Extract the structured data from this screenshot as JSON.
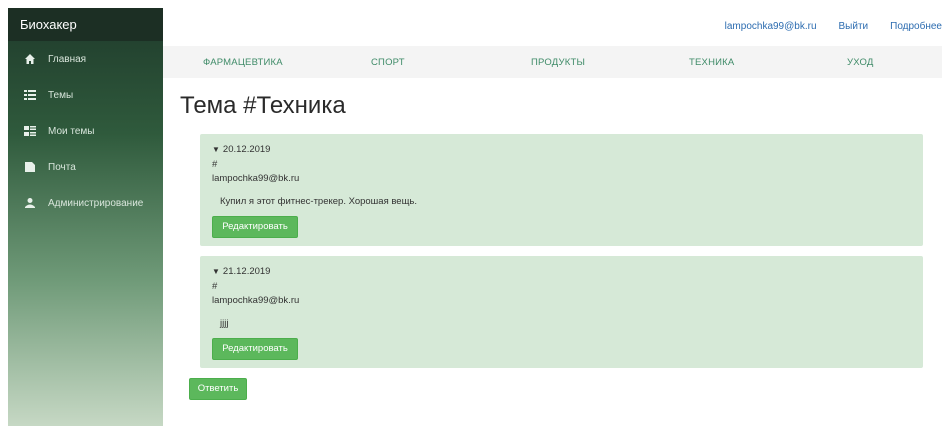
{
  "sidebar": {
    "brand": "Биохакер",
    "items": [
      {
        "label": "Главная",
        "icon": "home-icon"
      },
      {
        "label": "Темы",
        "icon": "list-icon"
      },
      {
        "label": "Мои темы",
        "icon": "my-list-icon"
      },
      {
        "label": "Почта",
        "icon": "mail-icon"
      },
      {
        "label": "Администрирование",
        "icon": "user-icon"
      }
    ]
  },
  "topbar": {
    "email": "lampochka99@bk.ru",
    "logout": "Выйти",
    "more": "Подробнее"
  },
  "categories": [
    "ФАРМАЦЕВТИКА",
    "СПОРТ",
    "ПРОДУКТЫ",
    "ТЕХНИКА",
    "УХОД"
  ],
  "page": {
    "title": "Тема #Техника"
  },
  "posts": [
    {
      "date": "20.12.2019",
      "hash": "#",
      "author": "lampochka99@bk.ru",
      "message": "Купил я этот фитнес-трекер. Хорошая вещь.",
      "edit_label": "Редактировать"
    },
    {
      "date": "21.12.2019",
      "hash": "#",
      "author": "lampochka99@bk.ru",
      "message": "jjjj",
      "edit_label": "Редактировать"
    }
  ],
  "reply_label": "Ответить",
  "colors": {
    "accent_green": "#5cb85c",
    "post_bg": "#d6e9d7",
    "link_blue": "#2c6cb0",
    "category_green": "#3f8b68"
  }
}
